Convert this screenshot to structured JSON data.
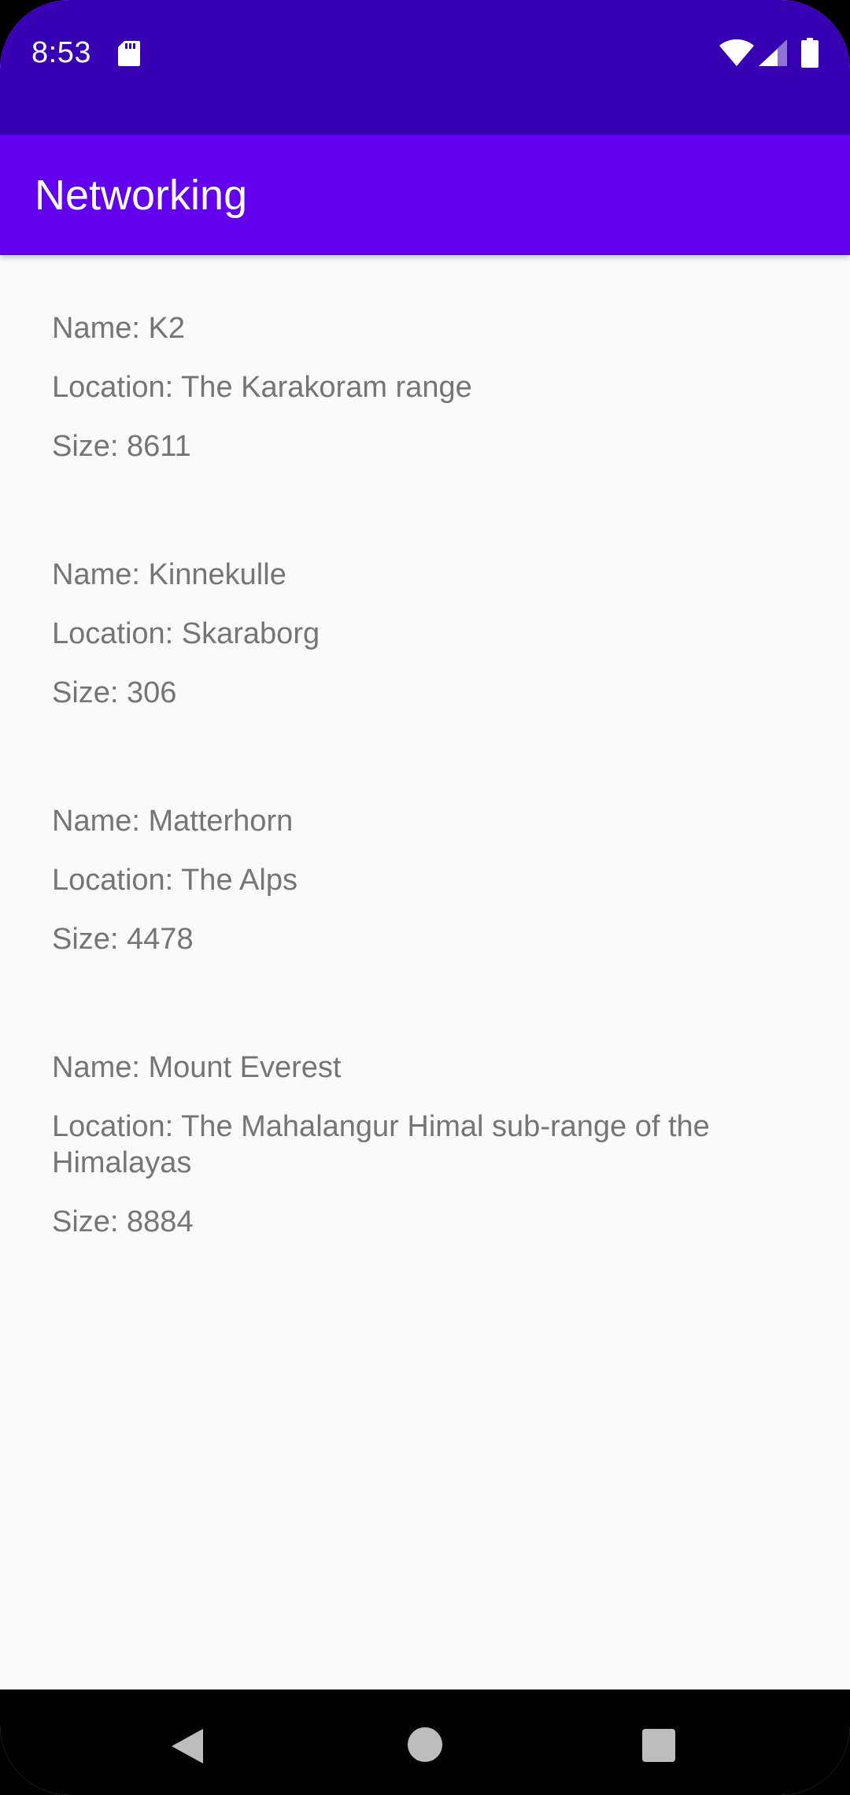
{
  "status_bar": {
    "time": "8:53",
    "icons": [
      "sd-card-icon",
      "wifi-icon",
      "signal-icon",
      "battery-icon"
    ]
  },
  "app_bar": {
    "title": "Networking"
  },
  "mountains": [
    {
      "name": "Name: K2",
      "location": "Location: The Karakoram range",
      "size": "Size: 8611"
    },
    {
      "name": "Name: Kinnekulle",
      "location": "Location: Skaraborg",
      "size": "Size: 306"
    },
    {
      "name": "Name: Matterhorn",
      "location": "Location: The Alps",
      "size": "Size: 4478"
    },
    {
      "name": "Name: Mount Everest",
      "location": "Location: The Mahalangur Himal sub-range of the Himalayas",
      "size": "Size: 8884"
    }
  ],
  "nav_bar": {
    "icons": [
      "back-icon",
      "home-icon",
      "recents-icon"
    ]
  },
  "colors": {
    "status_bar": "#3700b3",
    "app_bar": "#6200ee",
    "background": "#fafafa",
    "text": "#757575"
  }
}
